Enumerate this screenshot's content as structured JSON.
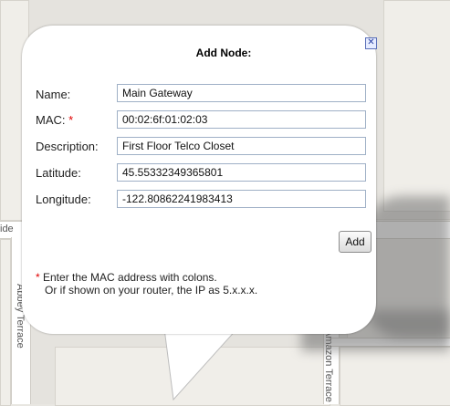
{
  "map": {
    "streets": [
      "Abbey Terrace",
      "Amazon Terrace",
      "ide"
    ]
  },
  "popup": {
    "title": "Add Node:",
    "close_icon": "close-icon",
    "required_mark": "*",
    "fields": {
      "name": {
        "label": "Name:",
        "value": "Main Gateway"
      },
      "mac": {
        "label": "MAC:",
        "value": "00:02:6f:01:02:03"
      },
      "description": {
        "label": "Description:",
        "value": "First Floor Telco Closet"
      },
      "latitude": {
        "label": "Latitude:",
        "value": "45.55332349365801"
      },
      "longitude": {
        "label": "Longitude:",
        "value": "-122.80862241983413"
      }
    },
    "add_button": "Add",
    "note_line1": " Enter the MAC address with colons.",
    "note_line2": "Or if shown on your router, the IP as 5.x.x.x."
  }
}
